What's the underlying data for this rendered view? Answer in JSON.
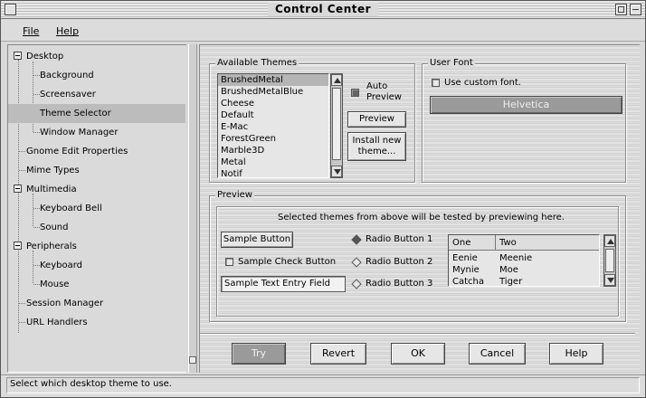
{
  "window": {
    "title": "Control Center"
  },
  "menu": {
    "file": "File",
    "help": "Help"
  },
  "tree": {
    "desktop": "Desktop",
    "background": "Background",
    "screensaver": "Screensaver",
    "theme_selector": "Theme Selector",
    "window_manager": "Window Manager",
    "gnome_edit": "Gnome Edit Properties",
    "mime_types": "Mime Types",
    "multimedia": "Multimedia",
    "keyboard_bell": "Keyboard Bell",
    "sound": "Sound",
    "peripherals": "Peripherals",
    "keyboard": "Keyboard",
    "mouse": "Mouse",
    "session_manager": "Session Manager",
    "url_handlers": "URL Handlers"
  },
  "themes": {
    "frame_label": "Available Themes",
    "items": [
      "BrushedMetal",
      "BrushedMetalBlue",
      "Cheese",
      "Default",
      "E-Mac",
      "ForestGreen",
      "Marble3D",
      "Metal",
      "Notif"
    ],
    "auto_preview_label": "Auto",
    "auto_preview_label2": "Preview",
    "preview_button": "Preview",
    "install_button_line1": "Install new",
    "install_button_line2": "theme..."
  },
  "user_font": {
    "frame_label": "User Font",
    "checkbox_label": "Use custom font.",
    "font_button": "Helvetica"
  },
  "preview": {
    "frame_label": "Preview",
    "description": "Selected themes from above will be tested by previewing here.",
    "sample_button": "Sample Button",
    "sample_check": "Sample Check Button",
    "sample_entry": "Sample Text Entry Field",
    "radio1": "Radio Button 1",
    "radio2": "Radio Button 2",
    "radio3": "Radio Button 3",
    "table": {
      "columns": [
        "One",
        "Two"
      ],
      "rows": [
        [
          "Eenie",
          "Meenie"
        ],
        [
          "Mynie",
          "Moe"
        ],
        [
          "Catcha",
          "Tiger"
        ]
      ]
    }
  },
  "buttons": {
    "try": "Try",
    "revert": "Revert",
    "ok": "OK",
    "cancel": "Cancel",
    "help": "Help"
  },
  "status": {
    "text": "Select which desktop theme to use."
  }
}
